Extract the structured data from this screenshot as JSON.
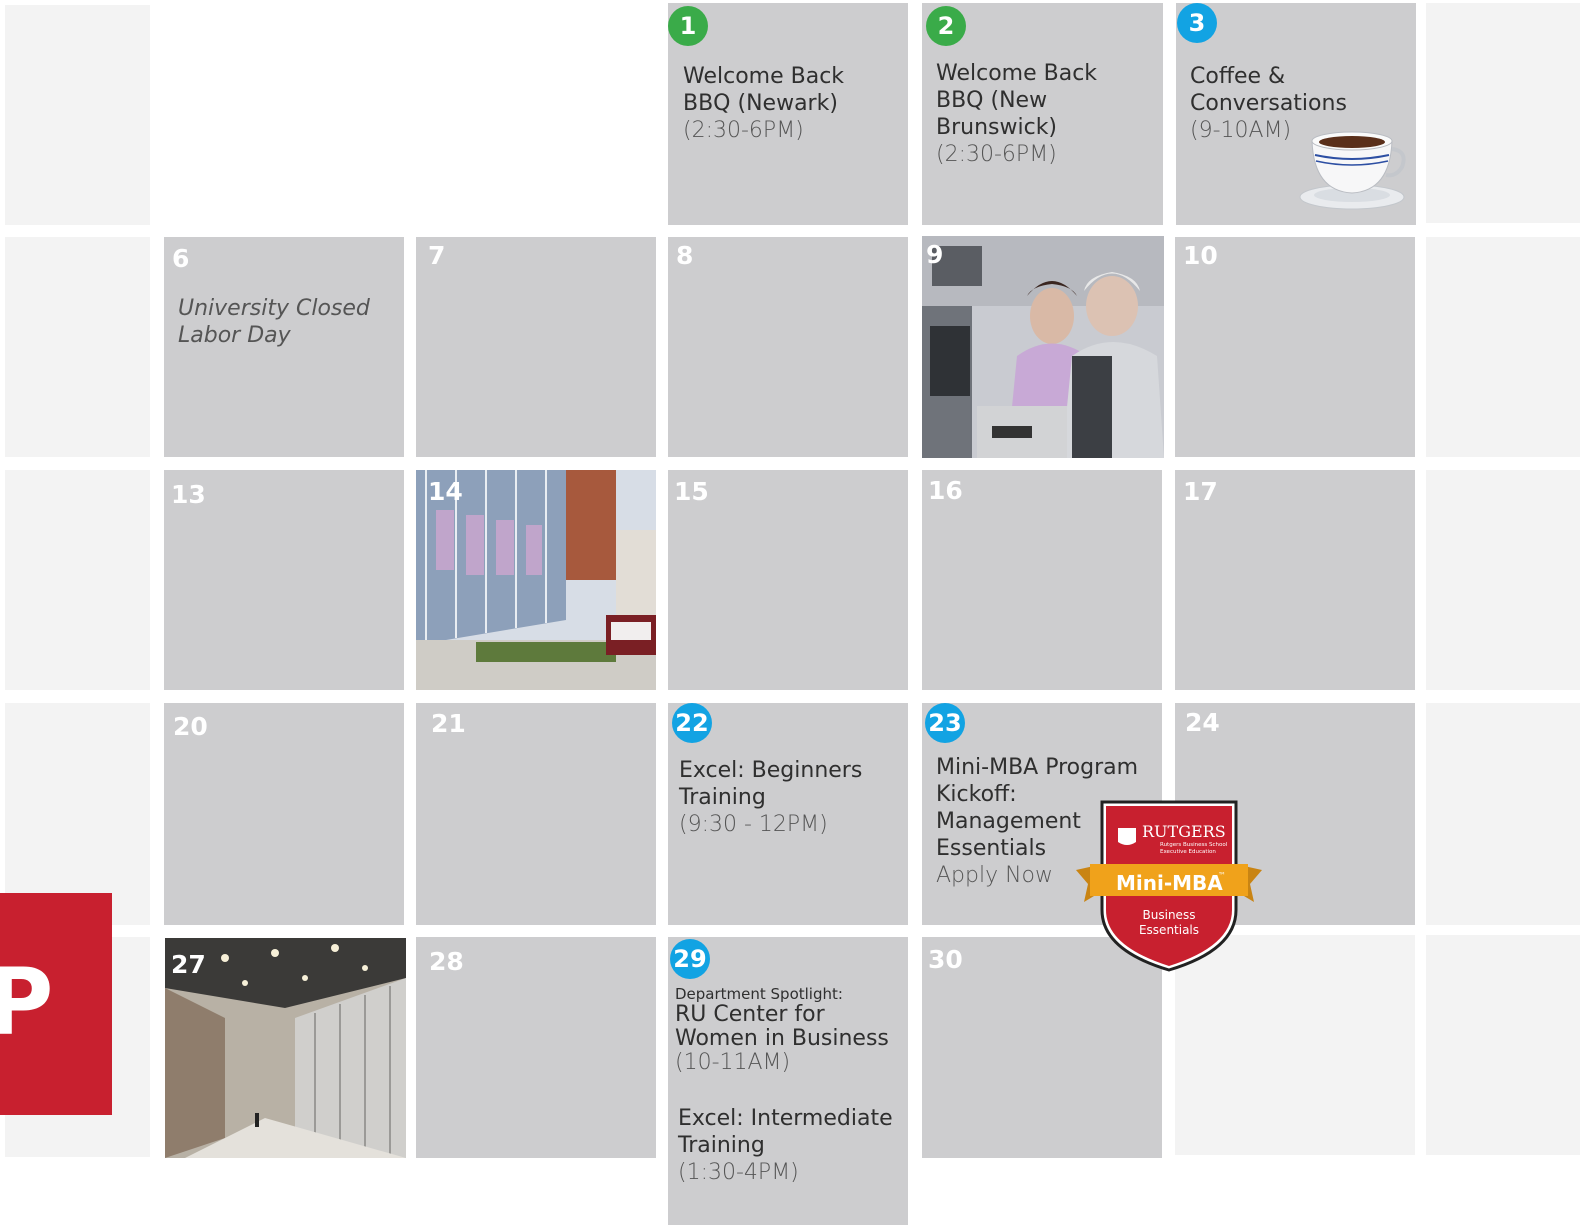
{
  "weeks": [
    {
      "days": [
        {
          "num": "1",
          "badge": "green",
          "title": "Welcome Back BBQ (Newark)",
          "time": "(2:30-6PM)"
        },
        {
          "num": "2",
          "badge": "green",
          "title": "Welcome Back BBQ (New Brunswick)",
          "time": "(2:30-6PM)"
        },
        {
          "num": "3",
          "badge": "blue",
          "title": "Coffee & Conversations",
          "time": "(9-10AM)",
          "icon": "coffee-cup-icon"
        }
      ]
    },
    {
      "days": [
        {
          "num": "6",
          "note_line1": "University Closed",
          "note_line2": "Labor Day"
        },
        {
          "num": "7"
        },
        {
          "num": "8"
        },
        {
          "num": "9",
          "image": "training-room-photo"
        },
        {
          "num": "10"
        }
      ]
    },
    {
      "days": [
        {
          "num": "13"
        },
        {
          "num": "14",
          "image": "campus-building-photo"
        },
        {
          "num": "15"
        },
        {
          "num": "16"
        },
        {
          "num": "17"
        }
      ]
    },
    {
      "days": [
        {
          "num": "20"
        },
        {
          "num": "21"
        },
        {
          "num": "22",
          "badge": "blue",
          "title": "Excel: Beginners Training",
          "time": "(9:30 - 12PM)"
        },
        {
          "num": "23",
          "badge": "blue",
          "title": "Mini-MBA Program Kickoff: Management Essentials",
          "link": "Apply Now"
        },
        {
          "num": "24"
        }
      ]
    },
    {
      "days": [
        {
          "num": "27",
          "image": "atrium-photo"
        },
        {
          "num": "28"
        },
        {
          "num": "29",
          "badge": "blue",
          "pre": "Department Spotlight:",
          "title": "RU Center for Women in Business",
          "time": "(10-11AM)",
          "title2": "Excel: Intermediate Training",
          "time2": "(1:30-4PM)"
        },
        {
          "num": "30"
        }
      ]
    }
  ],
  "mini_mba_badge": {
    "brand": "RUTGERS",
    "sub1": "Rutgers Business School",
    "sub2": "Executive Education",
    "ribbon": "Mini-MBA",
    "tm": "™",
    "line1": "Business",
    "line2": "Essentials"
  },
  "red_tile_letter": "P",
  "colors": {
    "cell_gray": "#cdcdcf",
    "cell_light": "#f3f3f3",
    "badge_green": "#3aab49",
    "badge_blue": "#12a3e3",
    "rutgers_red": "#c8202f",
    "ribbon_gold": "#f0a21b"
  }
}
